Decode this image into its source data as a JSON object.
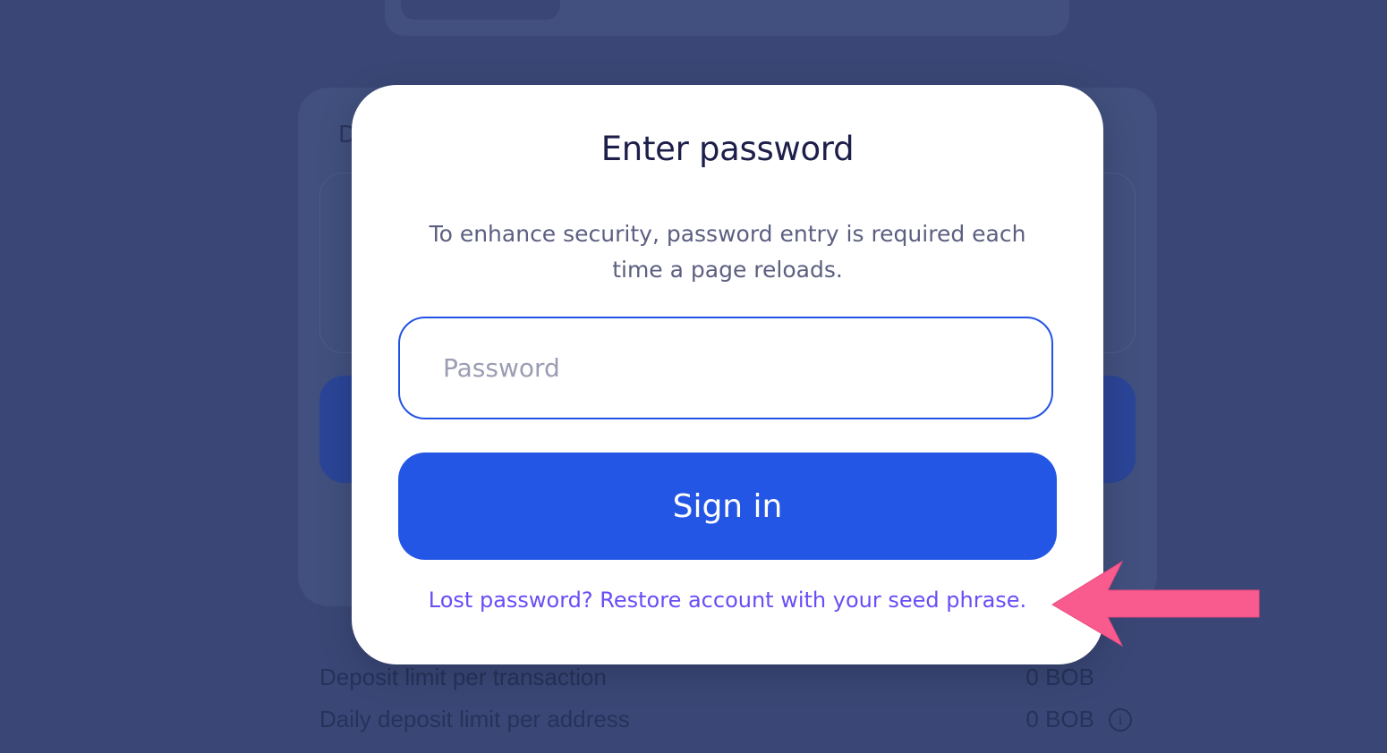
{
  "background": {
    "letter": "D",
    "limits": [
      {
        "label": "Deposit limit per transaction",
        "value": "0 BOB"
      },
      {
        "label": "Daily deposit limit per address",
        "value": "0 BOB"
      }
    ]
  },
  "modal": {
    "title": "Enter password",
    "description": "To enhance security, password entry is required each time a page reloads.",
    "password_placeholder": "Password",
    "signin_label": "Sign in",
    "restore_link": "Lost password? Restore account with your seed phrase."
  },
  "colors": {
    "accent": "#2456e6",
    "link": "#6a4df5",
    "annotation_arrow": "#fa5b8f",
    "overlay": "#3a4776"
  },
  "icons": {
    "annotation": "arrow-left-icon",
    "info": "info-icon",
    "dropdown": "chevron-down-icon"
  }
}
